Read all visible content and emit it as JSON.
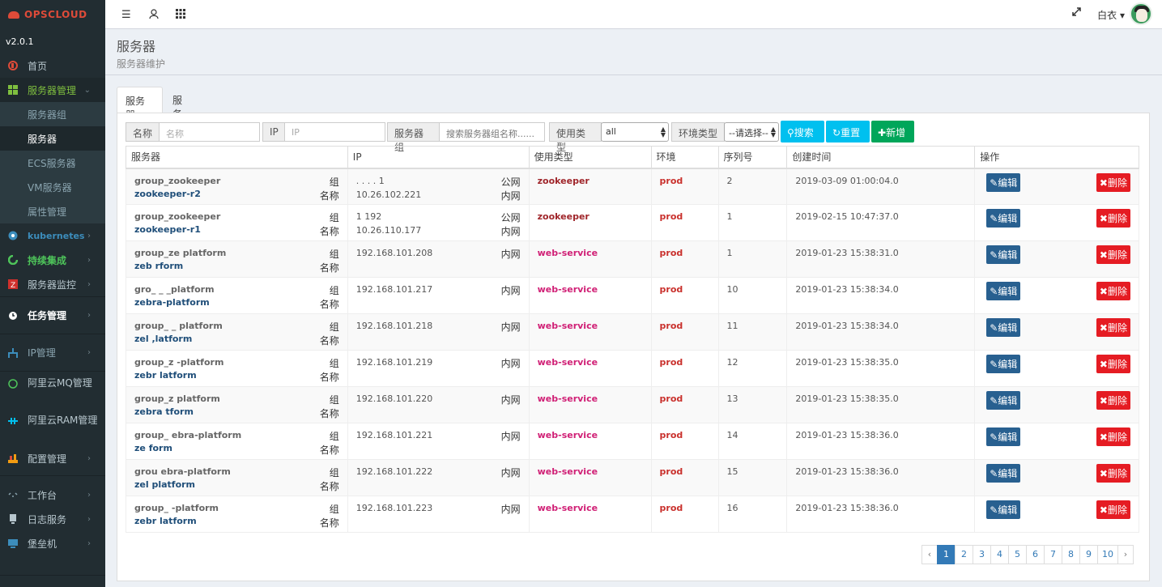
{
  "app": {
    "brand": "OPSCLOUD",
    "version": "v2.0.1"
  },
  "topbar": {
    "user": "白衣 ▾"
  },
  "sidebar": {
    "items": [
      {
        "label": "首页",
        "icon": "dashboard-icon"
      },
      {
        "label": "服务器管理",
        "icon": "windows-icon",
        "open": true,
        "children": [
          "服务器组",
          "服务器",
          "ECS服务器",
          "VM服务器",
          "属性管理"
        ]
      },
      {
        "label": "kubernetes",
        "icon": "kubernetes-icon"
      },
      {
        "label": "持续集成",
        "icon": "ci-icon"
      },
      {
        "label": "服务器监控",
        "icon": "zabbix-icon"
      },
      {
        "label": "任务管理",
        "icon": "task-icon"
      },
      {
        "label": "IP管理",
        "icon": "network-icon"
      },
      {
        "label": "阿里云MQ管理",
        "icon": "mq-icon"
      },
      {
        "label": "阿里云RAM管理",
        "icon": "ram-icon"
      },
      {
        "label": "配置管理",
        "icon": "config-icon"
      },
      {
        "label": "工作台",
        "icon": "workbench-icon"
      },
      {
        "label": "日志服务",
        "icon": "log-icon"
      },
      {
        "label": "堡垒机",
        "icon": "bastion-icon"
      }
    ]
  },
  "header": {
    "title": "服务器",
    "subtitle": "服务器维护"
  },
  "tabs": [
    "服务器",
    "服务器&属性"
  ],
  "filters": {
    "name_label": "名称",
    "name_placeholder": "名称",
    "ip_label": "IP",
    "ip_placeholder": "IP",
    "group_label": "服务器组",
    "group_placeholder": "搜索服务器组名称......",
    "usage_label": "使用类型",
    "usage_value": "all",
    "env_label": "环境类型",
    "env_value": "--请选择--",
    "search": "搜索",
    "reset": "重置",
    "add": "新增"
  },
  "table": {
    "columns": [
      "服务器",
      "IP",
      "使用类型",
      "环境",
      "序列号",
      "创建时间",
      "操作"
    ],
    "tag_group": "组",
    "tag_name": "名称",
    "tag_public": "公网",
    "tag_private": "内网",
    "edit": "编辑",
    "delete": "删除",
    "rows": [
      {
        "group": "group_zookeeper",
        "name": "zookeeper-r2",
        "public_ip": "  . .  .  .  1",
        "ip": "10.26.102.221",
        "type": "zookeeper",
        "env": "prod",
        "serial": "2",
        "created": "2019-03-09 01:00:04.0"
      },
      {
        "group": "group_zookeeper",
        "name": "zookeeper-r1",
        "public_ip": "1           192",
        "ip": "10.26.110.177",
        "type": "zookeeper",
        "env": "prod",
        "serial": "1",
        "created": "2019-02-15 10:47:37.0"
      },
      {
        "group": "group_ze       platform",
        "name": "zeb          rform",
        "ip": "192.168.101.208",
        "type": "web-service",
        "env": "prod",
        "serial": "1",
        "created": "2019-01-23 15:38:31.0"
      },
      {
        "group": "gro_    _   _platform",
        "name": "zebra-platform",
        "ip": "192.168.101.217",
        "type": "web-service",
        "env": "prod",
        "serial": "10",
        "created": "2019-01-23 15:38:34.0"
      },
      {
        "group": "group_    _    platform",
        "name": "zel     ,latform",
        "ip": "192.168.101.218",
        "type": "web-service",
        "env": "prod",
        "serial": "11",
        "created": "2019-01-23 15:38:34.0"
      },
      {
        "group": "group_z     -platform",
        "name": "zebr     latform",
        "ip": "192.168.101.219",
        "type": "web-service",
        "env": "prod",
        "serial": "12",
        "created": "2019-01-23 15:38:35.0"
      },
      {
        "group": "group_z        platform",
        "name": "zebra   tform",
        "ip": "192.168.101.220",
        "type": "web-service",
        "env": "prod",
        "serial": "13",
        "created": "2019-01-23 15:38:35.0"
      },
      {
        "group": "group_    ebra-platform",
        "name": "ze        form",
        "ip": "192.168.101.221",
        "type": "web-service",
        "env": "prod",
        "serial": "14",
        "created": "2019-01-23 15:38:36.0"
      },
      {
        "group": "grou   ebra-platform",
        "name": "zel   platform",
        "ip": "192.168.101.222",
        "type": "web-service",
        "env": "prod",
        "serial": "15",
        "created": "2019-01-23 15:38:36.0"
      },
      {
        "group": "group_    -platform",
        "name": "zebr     latform",
        "ip": "192.168.101.223",
        "type": "web-service",
        "env": "prod",
        "serial": "16",
        "created": "2019-01-23 15:38:36.0"
      }
    ]
  },
  "pagination": {
    "prev": "‹",
    "next": "›",
    "pages": [
      "1",
      "2",
      "3",
      "4",
      "5",
      "6",
      "7",
      "8",
      "9",
      "10"
    ],
    "current": "1"
  }
}
